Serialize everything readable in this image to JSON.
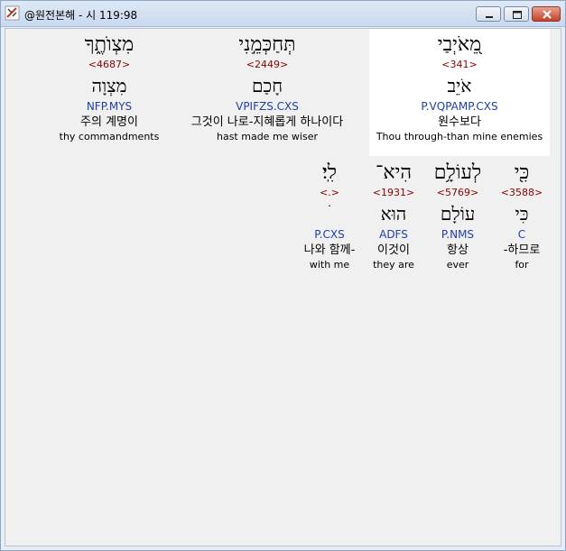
{
  "window": {
    "title": "@원전본해 - 시 119:98",
    "controls": {
      "minimize_icon": "minimize-icon",
      "maximize_icon": "maximize-icon",
      "close_icon": "close-icon"
    }
  },
  "words": [
    {
      "heb": "מִצְוֺתֶ֑ךָ",
      "strong": "<4687>",
      "lemma": "מִצְוָה",
      "morph": "NFP.MYS",
      "kor": "주의 계명이",
      "eng": "thy commandments"
    },
    {
      "heb": "תְּחַכְּמֵ֣נִי",
      "strong": "<2449>",
      "lemma": "חָכַם",
      "morph": "VPIFZS.CXS",
      "kor": "그것이 나로-지혜롭게 하나이다",
      "eng": "hast made me wiser"
    },
    {
      "heb": "מֵ֭אֹיְבַי",
      "strong": "<341>",
      "lemma": "אֹיֵב",
      "morph": "P.VQPAMP.CXS",
      "kor": "원수보다",
      "eng": "Thou through-than mine enemies",
      "selected": true
    },
    {
      "heb": "לִֽי׃",
      "strong": "<.>",
      "lemma": "ׄ",
      "morph": "P.CXS",
      "kor": "나와 함께-",
      "eng": "with me"
    },
    {
      "heb": "הִיא־",
      "strong": "<1931>",
      "lemma": "הוּא",
      "morph": "ADFS",
      "kor": "이것이",
      "eng": "they are"
    },
    {
      "heb": "לְעוֹלָ֥ם",
      "strong": "<5769>",
      "lemma": "עוֹלָם",
      "morph": "P.NMS",
      "kor": "항상",
      "eng": "ever"
    },
    {
      "heb": "כִּ֖י",
      "strong": "<3588>",
      "lemma": "כִּי",
      "morph": "C",
      "kor": "-하므로",
      "eng": "for"
    }
  ]
}
